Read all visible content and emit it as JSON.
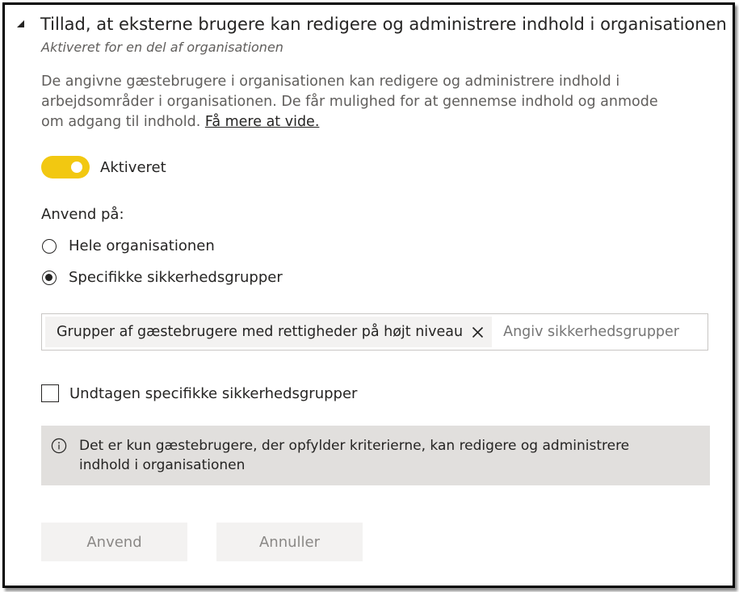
{
  "section": {
    "title": "Tillad, at eksterne brugere kan redigere og administrere indhold i organisationen",
    "subtitle": "Aktiveret for en del af organisationen",
    "description": "De angivne gæstebrugere i organisationen kan redigere og administrere indhold i arbejdsområder i organisationen. De får mulighed for at gennemse indhold og anmode om adgang til indhold.",
    "learn_more": "Få mere at vide."
  },
  "toggle": {
    "label": "Aktiveret",
    "state": "on",
    "color": "#f2c811"
  },
  "apply_to": {
    "label": "Anvend på:",
    "options": [
      {
        "label": "Hele organisationen",
        "selected": false
      },
      {
        "label": "Specifikke sikkerhedsgrupper",
        "selected": true
      }
    ]
  },
  "groups_input": {
    "tags": [
      "Grupper af gæstebrugere med rettigheder på højt niveau"
    ],
    "placeholder": "Angiv sikkerhedsgrupper"
  },
  "exclude": {
    "label": "Undtagen specifikke sikkerhedsgrupper",
    "checked": false
  },
  "info": {
    "text": "Det er kun gæstebrugere, der opfylder kriterierne, kan redigere og administrere indhold i organisationen"
  },
  "buttons": {
    "apply": "Anvend",
    "cancel": "Annuller"
  }
}
